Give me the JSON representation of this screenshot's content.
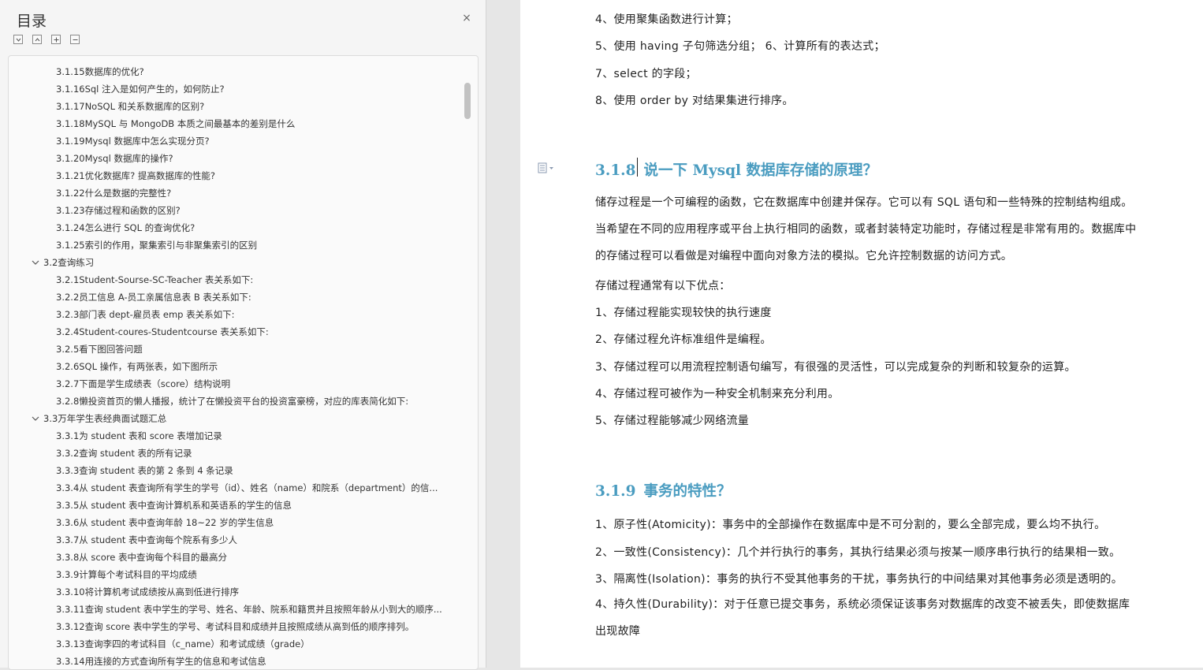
{
  "toc": {
    "title": "目录",
    "close_glyph": "×",
    "toolbar": [
      "collapse-all-icon",
      "expand-level-icon",
      "plus-icon",
      "minus-icon"
    ],
    "items": [
      {
        "level": 3,
        "text": "3.1.15数据库的优化?"
      },
      {
        "level": 3,
        "text": "3.1.16Sql 注入是如何产生的，如何防止?"
      },
      {
        "level": 3,
        "text": "3.1.17NoSQL 和关系数据库的区别?"
      },
      {
        "level": 3,
        "text": "3.1.18MySQL 与 MongoDB 本质之间最基本的差别是什么"
      },
      {
        "level": 3,
        "text": "3.1.19Mysql 数据库中怎么实现分页?"
      },
      {
        "level": 3,
        "text": "3.1.20Mysql 数据库的操作?"
      },
      {
        "level": 3,
        "text": "3.1.21优化数据库? 提高数据库的性能?"
      },
      {
        "level": 3,
        "text": "3.1.22什么是数据的完整性?"
      },
      {
        "level": 3,
        "text": "3.1.23存储过程和函数的区别?"
      },
      {
        "level": 3,
        "text": "3.1.24怎么进行 SQL 的查询优化?"
      },
      {
        "level": 3,
        "text": "3.1.25索引的作用，聚集索引与非聚集索引的区别"
      },
      {
        "level": 2,
        "text": "3.2查询练习",
        "expanded": true
      },
      {
        "level": 3,
        "text": "3.2.1Student-Sourse-SC-Teacher 表关系如下:"
      },
      {
        "level": 3,
        "text": "3.2.2员工信息 A-员工亲属信息表 B 表关系如下:"
      },
      {
        "level": 3,
        "text": "3.2.3部门表 dept-雇员表 emp 表关系如下:"
      },
      {
        "level": 3,
        "text": "3.2.4Student-coures-Studentcourse 表关系如下:"
      },
      {
        "level": 3,
        "text": "3.2.5看下图回答问题"
      },
      {
        "level": 3,
        "text": "3.2.6SQL 操作，有两张表，如下图所示"
      },
      {
        "level": 3,
        "text": "3.2.7下面是学生成绩表（score）结构说明"
      },
      {
        "level": 3,
        "text": "3.2.8懒投资首页的懒人播报，统计了在懒投资平台的投资富豪榜，对应的库表简化如下:"
      },
      {
        "level": 2,
        "text": "3.3万年学生表经典面试题汇总",
        "expanded": true
      },
      {
        "level": 3,
        "text": "3.3.1为 student 表和 score 表增加记录"
      },
      {
        "level": 3,
        "text": "3.3.2查询 student 表的所有记录"
      },
      {
        "level": 3,
        "text": "3.3.3查询 student 表的第 2 条到 4 条记录"
      },
      {
        "level": 3,
        "text": "3.3.4从 student 表查询所有学生的学号（id）、姓名（name）和院系（department）的信..."
      },
      {
        "level": 3,
        "text": "3.3.5从 student 表中查询计算机系和英语系的学生的信息"
      },
      {
        "level": 3,
        "text": "3.3.6从 student 表中查询年龄 18~22 岁的学生信息"
      },
      {
        "level": 3,
        "text": "3.3.7从 student 表中查询每个院系有多少人"
      },
      {
        "level": 3,
        "text": "3.3.8从 score 表中查询每个科目的最高分"
      },
      {
        "level": 3,
        "text": "3.3.9计算每个考试科目的平均成绩"
      },
      {
        "level": 3,
        "text": "3.3.10将计算机考试成绩按从高到低进行排序"
      },
      {
        "level": 3,
        "text": "3.3.11查询 student 表中学生的学号、姓名、年龄、院系和籍贯并且按照年龄从小到大的顺序..."
      },
      {
        "level": 3,
        "text": "3.3.12查询 score 表中学生的学号、考试科目和成绩并且按照成绩从高到低的顺序排列。"
      },
      {
        "level": 3,
        "text": "3.3.13查询李四的考试科目（c_name）和考试成绩（grade）"
      },
      {
        "level": 3,
        "text": "3.3.14用连接的方式查询所有学生的信息和考试信息"
      }
    ]
  },
  "doc": {
    "lines_top": [
      "4、使用聚集函数进行计算；",
      "5、使用  having  子句筛选分组；   6、计算所有的表达式；",
      "7、select  的字段；",
      "8、使用  order by  对结果集进行排序。"
    ],
    "section_318": {
      "number": "3.1.8",
      "title": "说一下  Mysql  数据库存储的原理？",
      "paragraph": "储存过程是一个可编程的函数，它在数据库中创建并保存。它可以有  SQL  语句和一些特殊的控制结构组成。当希望在不同的应用程序或平台上执行相同的函数，或者封装特定功能时，存储过程是非常有用的。数据库中的存储过程可以看做是对编程中面向对象方法的模拟。它允许控制数据的访问方式。",
      "intro": "存储过程通常有以下优点：",
      "points": [
        "1、存储过程能实现较快的执行速度",
        "2、存储过程允许标准组件是编程。",
        "3、存储过程可以用流程控制语句编写，有很强的灵活性，可以完成复杂的判断和较复杂的运算。",
        "4、存储过程可被作为一种安全机制来充分利用。",
        "5、存储过程能够减少网络流量"
      ]
    },
    "section_319": {
      "number": "3.1.9",
      "title": "事务的特性？",
      "points": [
        "1、原子性(Atomicity)：事务中的全部操作在数据库中是不可分割的，要么全部完成，要么均不执行。",
        "2、一致性(Consistency)：几个并行执行的事务，其执行结果必须与按某一顺序串行执行的结果相一致。",
        "3、隔离性(Isolation)：事务的执行不受其他事务的干扰，事务执行的中间结果对其他事务必须是透明的。",
        "4、持久性(Durability)：对于任意已提交事务，系统必须保证该事务对数据库的改变不被丢失，即使数据库出现故障"
      ]
    },
    "paragraph_icon": "paragraph-settings-icon",
    "heading_color": "#4a9cc0"
  }
}
